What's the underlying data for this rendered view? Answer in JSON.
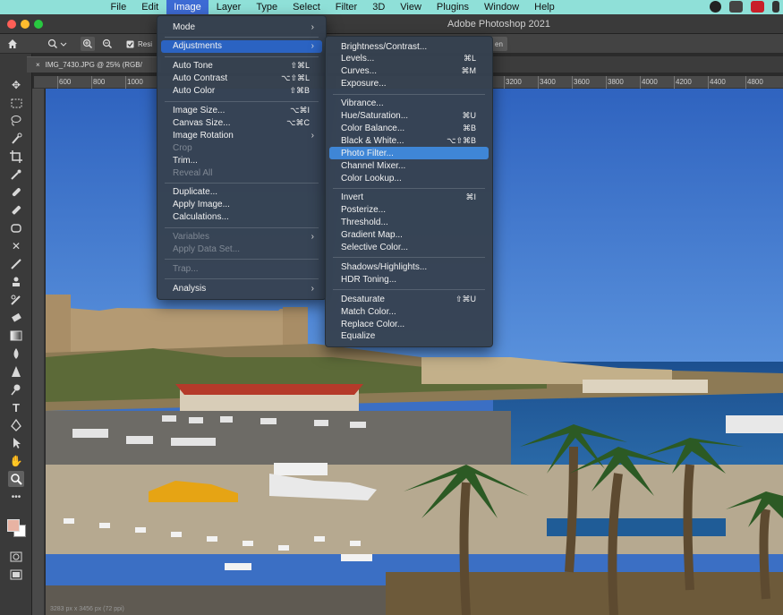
{
  "menubar": {
    "items": [
      "File",
      "Edit",
      "Image",
      "Layer",
      "Type",
      "Select",
      "Filter",
      "3D",
      "View",
      "Plugins",
      "Window",
      "Help"
    ],
    "active": "Image"
  },
  "titlebar": {
    "title": "Adobe Photoshop 2021"
  },
  "options": {
    "button_label": "Resi",
    "right_fragment": "en"
  },
  "document_tab": {
    "label": "IMG_7430.JPG @ 25% (RGB/"
  },
  "ruler_ticks": [
    "600",
    "800",
    "1000",
    "3200",
    "3400",
    "3600",
    "3800",
    "4000",
    "4200",
    "4400",
    "4800"
  ],
  "status_text": "3283 px x 3456 px (72 ppi)",
  "image_menu": {
    "items": [
      {
        "label": "Mode",
        "shortcut": "",
        "submenu": true,
        "disabled": false
      },
      {
        "sep": true
      },
      {
        "label": "Adjustments",
        "shortcut": "",
        "submenu": true,
        "disabled": false,
        "highlight": true
      },
      {
        "sep": true
      },
      {
        "label": "Auto Tone",
        "shortcut": "⇧⌘L",
        "disabled": false
      },
      {
        "label": "Auto Contrast",
        "shortcut": "⌥⇧⌘L",
        "disabled": false
      },
      {
        "label": "Auto Color",
        "shortcut": "⇧⌘B",
        "disabled": false
      },
      {
        "sep": true
      },
      {
        "label": "Image Size...",
        "shortcut": "⌥⌘I",
        "disabled": false
      },
      {
        "label": "Canvas Size...",
        "shortcut": "⌥⌘C",
        "disabled": false
      },
      {
        "label": "Image Rotation",
        "shortcut": "",
        "submenu": true,
        "disabled": false
      },
      {
        "label": "Crop",
        "shortcut": "",
        "disabled": true
      },
      {
        "label": "Trim...",
        "shortcut": "",
        "disabled": false
      },
      {
        "label": "Reveal All",
        "shortcut": "",
        "disabled": true
      },
      {
        "sep": true
      },
      {
        "label": "Duplicate...",
        "shortcut": "",
        "disabled": false
      },
      {
        "label": "Apply Image...",
        "shortcut": "",
        "disabled": false
      },
      {
        "label": "Calculations...",
        "shortcut": "",
        "disabled": false
      },
      {
        "sep": true
      },
      {
        "label": "Variables",
        "shortcut": "",
        "submenu": true,
        "disabled": true
      },
      {
        "label": "Apply Data Set...",
        "shortcut": "",
        "disabled": true
      },
      {
        "sep": true
      },
      {
        "label": "Trap...",
        "shortcut": "",
        "disabled": true
      },
      {
        "sep": true
      },
      {
        "label": "Analysis",
        "shortcut": "",
        "submenu": true,
        "disabled": false
      }
    ]
  },
  "adjustments_menu": {
    "items": [
      {
        "label": "Brightness/Contrast...",
        "shortcut": ""
      },
      {
        "label": "Levels...",
        "shortcut": "⌘L"
      },
      {
        "label": "Curves...",
        "shortcut": "⌘M"
      },
      {
        "label": "Exposure...",
        "shortcut": ""
      },
      {
        "sep": true
      },
      {
        "label": "Vibrance...",
        "shortcut": ""
      },
      {
        "label": "Hue/Saturation...",
        "shortcut": "⌘U"
      },
      {
        "label": "Color Balance...",
        "shortcut": "⌘B"
      },
      {
        "label": "Black & White...",
        "shortcut": "⌥⇧⌘B"
      },
      {
        "label": "Photo Filter...",
        "shortcut": "",
        "highlight": true
      },
      {
        "label": "Channel Mixer...",
        "shortcut": ""
      },
      {
        "label": "Color Lookup...",
        "shortcut": ""
      },
      {
        "sep": true
      },
      {
        "label": "Invert",
        "shortcut": "⌘I"
      },
      {
        "label": "Posterize...",
        "shortcut": ""
      },
      {
        "label": "Threshold...",
        "shortcut": ""
      },
      {
        "label": "Gradient Map...",
        "shortcut": ""
      },
      {
        "label": "Selective Color...",
        "shortcut": ""
      },
      {
        "sep": true
      },
      {
        "label": "Shadows/Highlights...",
        "shortcut": ""
      },
      {
        "label": "HDR Toning...",
        "shortcut": ""
      },
      {
        "sep": true
      },
      {
        "label": "Desaturate",
        "shortcut": "⇧⌘U"
      },
      {
        "label": "Match Color...",
        "shortcut": ""
      },
      {
        "label": "Replace Color...",
        "shortcut": ""
      },
      {
        "label": "Equalize",
        "shortcut": ""
      }
    ]
  },
  "tools": [
    "move-tool",
    "marquee-tool",
    "lasso-tool",
    "quick-selection-tool",
    "crop-tool",
    "eyedropper-tool",
    "healing-brush-tool",
    "brush-tool",
    "stamp-tool",
    "history-brush-tool",
    "eraser-tool",
    "gradient-tool",
    "blur-tool",
    "dodge-tool",
    "pen-tool",
    "type-tool",
    "path-selection-tool",
    "rectangle-tool",
    "hand-tool",
    "zoom-tool",
    "more-tools"
  ],
  "colors": {
    "accent": "#2b63c2",
    "menubar": "#8fe0d8",
    "foreground_swatch": "#e8b3a3",
    "background_swatch": "#ffffff"
  }
}
